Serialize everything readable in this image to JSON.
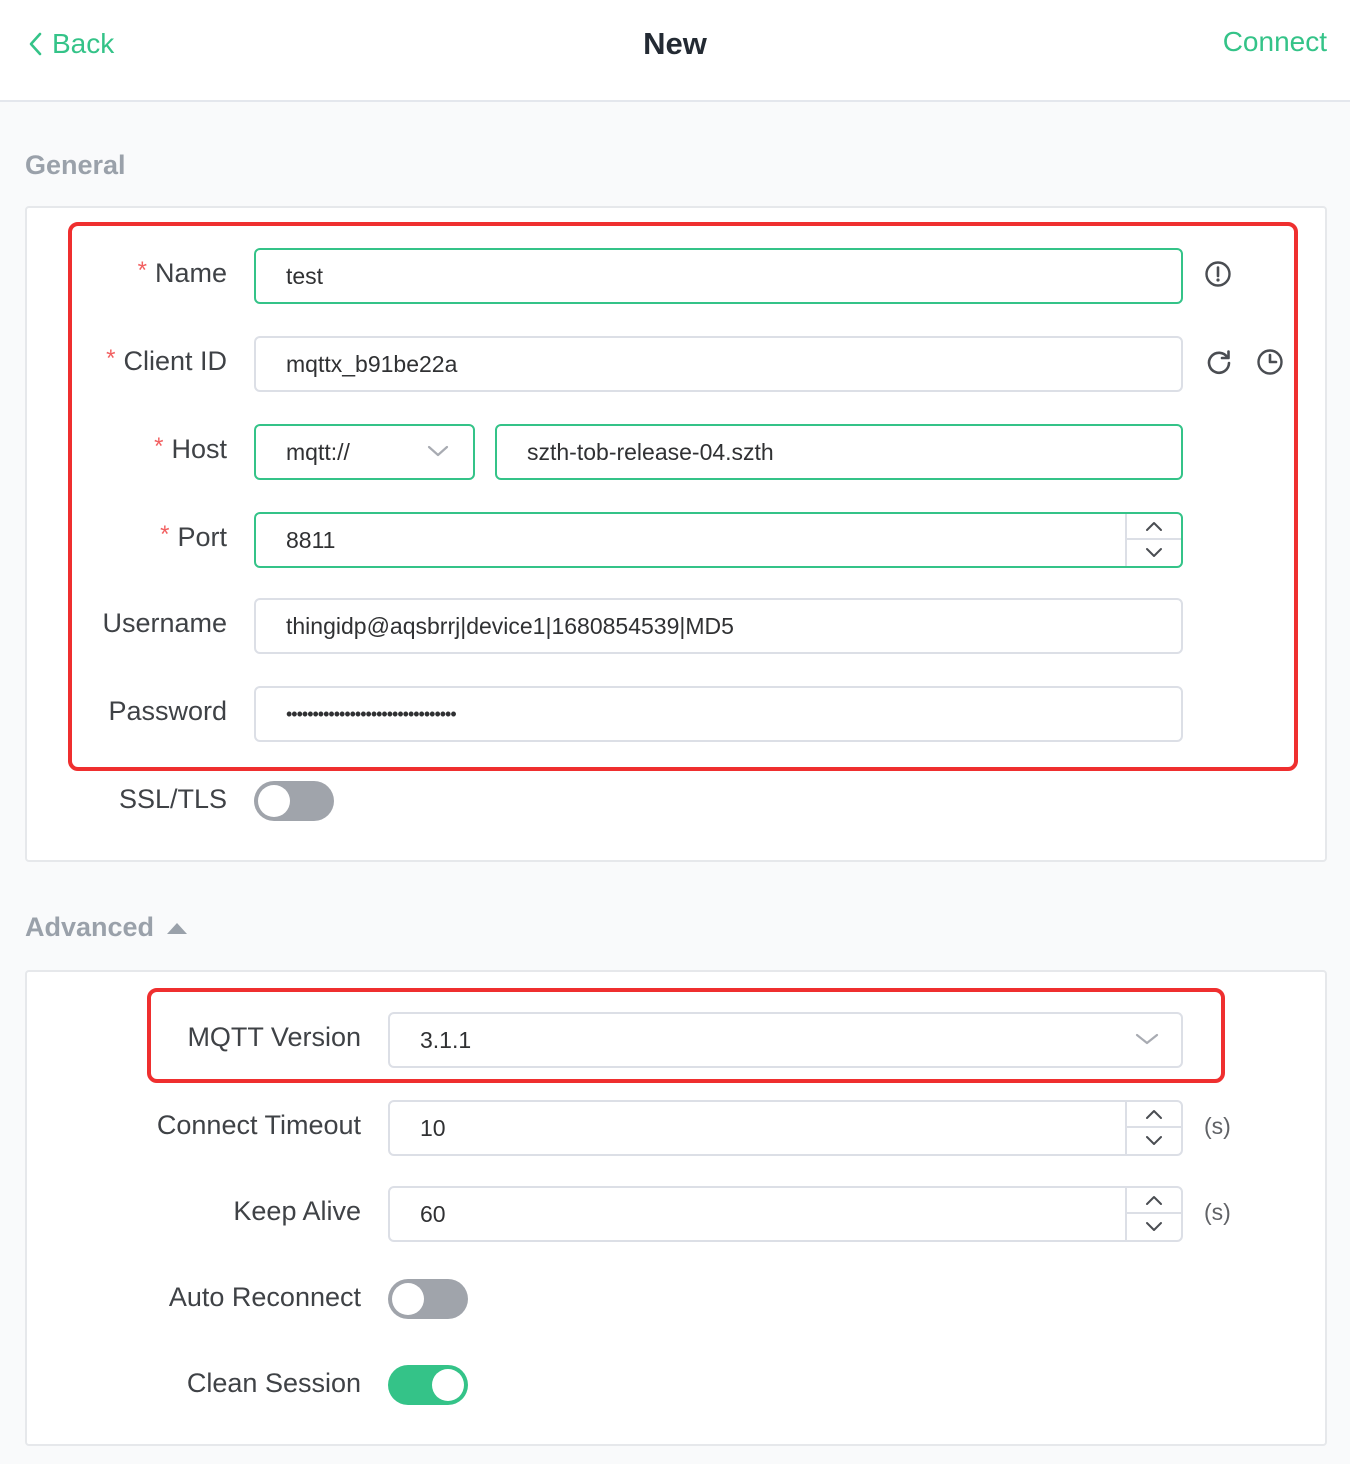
{
  "header": {
    "back_label": "Back",
    "title": "New",
    "connect_label": "Connect"
  },
  "general": {
    "title": "General",
    "name": {
      "label": "Name",
      "value": "test"
    },
    "client_id": {
      "label": "Client ID",
      "value": "mqttx_b91be22a"
    },
    "host": {
      "label": "Host",
      "protocol": "mqtt://",
      "value": "szth-tob-release-04.szth"
    },
    "port": {
      "label": "Port",
      "value": "8811"
    },
    "username": {
      "label": "Username",
      "value": "thingidp@aqsbrrj|device1|1680854539|MD5"
    },
    "password": {
      "label": "Password",
      "value": "••••••••••••••••••••••••••••••••"
    },
    "ssl": {
      "label": "SSL/TLS",
      "enabled": false
    },
    "required_mark": "*"
  },
  "advanced": {
    "title": "Advanced",
    "mqtt_version": {
      "label": "MQTT Version",
      "value": "3.1.1"
    },
    "connect_timeout": {
      "label": "Connect Timeout",
      "value": "10",
      "unit": "(s)"
    },
    "keep_alive": {
      "label": "Keep Alive",
      "value": "60",
      "unit": "(s)"
    },
    "auto_reconnect": {
      "label": "Auto Reconnect",
      "enabled": false
    },
    "clean_session": {
      "label": "Clean Session",
      "enabled": true
    }
  },
  "colors": {
    "accent": "#34c388",
    "highlight": "#ef2f2f",
    "required": "#f26061"
  },
  "icons": [
    "chevron-left-icon",
    "info-icon",
    "refresh-icon",
    "clock-icon",
    "chevron-down-icon",
    "chevron-up-icon",
    "caret-up-icon"
  ]
}
